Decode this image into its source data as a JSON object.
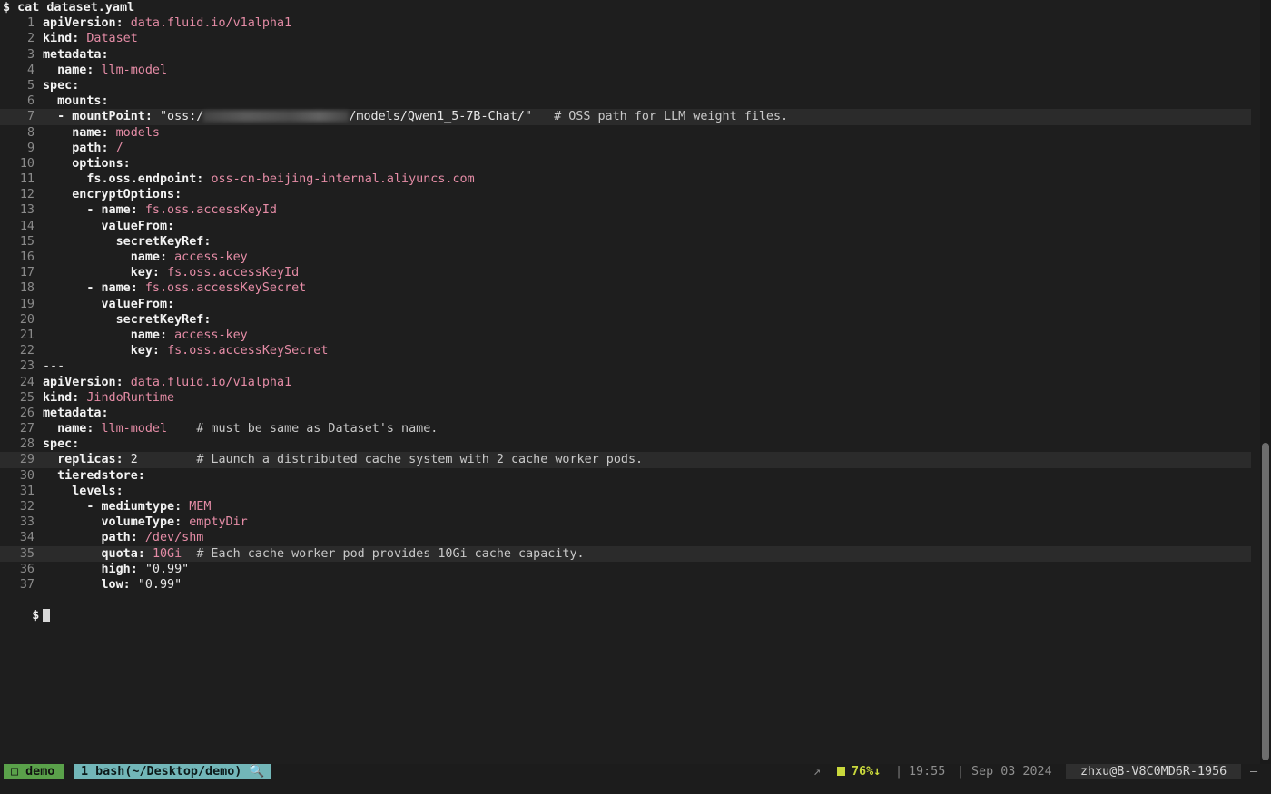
{
  "command": "$ cat dataset.yaml",
  "end_prompt": "$",
  "redacted_segment_icon": "blurred-redaction",
  "lines": [
    {
      "n": "1",
      "t": [
        [
          "key",
          "apiVersion:"
        ],
        [
          "plain",
          " "
        ],
        [
          "val",
          "data.fluid.io/v1alpha1"
        ]
      ]
    },
    {
      "n": "2",
      "t": [
        [
          "key",
          "kind:"
        ],
        [
          "plain",
          " "
        ],
        [
          "val",
          "Dataset"
        ]
      ]
    },
    {
      "n": "3",
      "t": [
        [
          "key",
          "metadata:"
        ]
      ]
    },
    {
      "n": "4",
      "t": [
        [
          "plain",
          "  "
        ],
        [
          "key",
          "name:"
        ],
        [
          "plain",
          " "
        ],
        [
          "val",
          "llm-model"
        ]
      ]
    },
    {
      "n": "5",
      "t": [
        [
          "key",
          "spec:"
        ]
      ]
    },
    {
      "n": "6",
      "t": [
        [
          "plain",
          "  "
        ],
        [
          "key",
          "mounts:"
        ]
      ]
    },
    {
      "n": "7",
      "hl": true,
      "t": [
        [
          "plain",
          "  "
        ],
        [
          "key",
          "- mountPoint:"
        ],
        [
          "plain",
          " "
        ],
        [
          "str",
          "\"oss:/"
        ],
        [
          "redact",
          ""
        ],
        [
          "str",
          "/models/Qwen1_5-7B-Chat/\""
        ],
        [
          "plain",
          "   "
        ],
        [
          "cmt",
          "# OSS path for LLM weight files."
        ]
      ]
    },
    {
      "n": "8",
      "t": [
        [
          "plain",
          "    "
        ],
        [
          "key",
          "name:"
        ],
        [
          "plain",
          " "
        ],
        [
          "val",
          "models"
        ]
      ]
    },
    {
      "n": "9",
      "t": [
        [
          "plain",
          "    "
        ],
        [
          "key",
          "path:"
        ],
        [
          "plain",
          " "
        ],
        [
          "val",
          "/"
        ]
      ]
    },
    {
      "n": "10",
      "t": [
        [
          "plain",
          "    "
        ],
        [
          "key",
          "options:"
        ]
      ]
    },
    {
      "n": "11",
      "t": [
        [
          "plain",
          "      "
        ],
        [
          "key",
          "fs.oss.endpoint:"
        ],
        [
          "plain",
          " "
        ],
        [
          "val",
          "oss-cn-beijing-internal.aliyuncs.com"
        ]
      ]
    },
    {
      "n": "12",
      "t": [
        [
          "plain",
          "    "
        ],
        [
          "key",
          "encryptOptions:"
        ]
      ]
    },
    {
      "n": "13",
      "t": [
        [
          "plain",
          "      "
        ],
        [
          "key",
          "- name:"
        ],
        [
          "plain",
          " "
        ],
        [
          "val",
          "fs.oss.accessKeyId"
        ]
      ]
    },
    {
      "n": "14",
      "t": [
        [
          "plain",
          "        "
        ],
        [
          "key",
          "valueFrom:"
        ]
      ]
    },
    {
      "n": "15",
      "t": [
        [
          "plain",
          "          "
        ],
        [
          "key",
          "secretKeyRef:"
        ]
      ]
    },
    {
      "n": "16",
      "t": [
        [
          "plain",
          "            "
        ],
        [
          "key",
          "name:"
        ],
        [
          "plain",
          " "
        ],
        [
          "val",
          "access-key"
        ]
      ]
    },
    {
      "n": "17",
      "t": [
        [
          "plain",
          "            "
        ],
        [
          "key",
          "key:"
        ],
        [
          "plain",
          " "
        ],
        [
          "val",
          "fs.oss.accessKeyId"
        ]
      ]
    },
    {
      "n": "18",
      "t": [
        [
          "plain",
          "      "
        ],
        [
          "key",
          "- name:"
        ],
        [
          "plain",
          " "
        ],
        [
          "val",
          "fs.oss.accessKeySecret"
        ]
      ]
    },
    {
      "n": "19",
      "t": [
        [
          "plain",
          "        "
        ],
        [
          "key",
          "valueFrom:"
        ]
      ]
    },
    {
      "n": "20",
      "t": [
        [
          "plain",
          "          "
        ],
        [
          "key",
          "secretKeyRef:"
        ]
      ]
    },
    {
      "n": "21",
      "t": [
        [
          "plain",
          "            "
        ],
        [
          "key",
          "name:"
        ],
        [
          "plain",
          " "
        ],
        [
          "val",
          "access-key"
        ]
      ]
    },
    {
      "n": "22",
      "t": [
        [
          "plain",
          "            "
        ],
        [
          "key",
          "key:"
        ],
        [
          "plain",
          " "
        ],
        [
          "val",
          "fs.oss.accessKeySecret"
        ]
      ]
    },
    {
      "n": "23",
      "t": [
        [
          "plain",
          "---"
        ]
      ]
    },
    {
      "n": "24",
      "t": [
        [
          "key",
          "apiVersion:"
        ],
        [
          "plain",
          " "
        ],
        [
          "val",
          "data.fluid.io/v1alpha1"
        ]
      ]
    },
    {
      "n": "25",
      "t": [
        [
          "key",
          "kind:"
        ],
        [
          "plain",
          " "
        ],
        [
          "val",
          "JindoRuntime"
        ]
      ]
    },
    {
      "n": "26",
      "t": [
        [
          "key",
          "metadata:"
        ]
      ]
    },
    {
      "n": "27",
      "t": [
        [
          "plain",
          "  "
        ],
        [
          "key",
          "name:"
        ],
        [
          "plain",
          " "
        ],
        [
          "val",
          "llm-model"
        ],
        [
          "plain",
          "    "
        ],
        [
          "cmt",
          "# must be same as Dataset's name."
        ]
      ]
    },
    {
      "n": "28",
      "t": [
        [
          "key",
          "spec:"
        ]
      ]
    },
    {
      "n": "29",
      "hl": true,
      "t": [
        [
          "plain",
          "  "
        ],
        [
          "key",
          "replicas:"
        ],
        [
          "plain",
          " "
        ],
        [
          "str",
          "2"
        ],
        [
          "plain",
          "        "
        ],
        [
          "cmt",
          "# Launch a distributed cache system with 2 cache worker pods."
        ]
      ]
    },
    {
      "n": "30",
      "t": [
        [
          "plain",
          "  "
        ],
        [
          "key",
          "tieredstore:"
        ]
      ]
    },
    {
      "n": "31",
      "t": [
        [
          "plain",
          "    "
        ],
        [
          "key",
          "levels:"
        ]
      ]
    },
    {
      "n": "32",
      "t": [
        [
          "plain",
          "      "
        ],
        [
          "key",
          "- mediumtype:"
        ],
        [
          "plain",
          " "
        ],
        [
          "val",
          "MEM"
        ]
      ]
    },
    {
      "n": "33",
      "t": [
        [
          "plain",
          "        "
        ],
        [
          "key",
          "volumeType:"
        ],
        [
          "plain",
          " "
        ],
        [
          "val",
          "emptyDir"
        ]
      ]
    },
    {
      "n": "34",
      "t": [
        [
          "plain",
          "        "
        ],
        [
          "key",
          "path:"
        ],
        [
          "plain",
          " "
        ],
        [
          "val",
          "/dev/shm"
        ]
      ]
    },
    {
      "n": "35",
      "hl": true,
      "t": [
        [
          "plain",
          "        "
        ],
        [
          "key",
          "quota:"
        ],
        [
          "plain",
          " "
        ],
        [
          "val",
          "10Gi"
        ],
        [
          "plain",
          "  "
        ],
        [
          "cmt",
          "# Each cache worker pod provides 10Gi cache capacity."
        ]
      ]
    },
    {
      "n": "36",
      "t": [
        [
          "plain",
          "        "
        ],
        [
          "key",
          "high:"
        ],
        [
          "plain",
          " "
        ],
        [
          "str",
          "\"0.99\""
        ]
      ]
    },
    {
      "n": "37",
      "t": [
        [
          "plain",
          "        "
        ],
        [
          "key",
          "low:"
        ],
        [
          "plain",
          " "
        ],
        [
          "str",
          "\"0.99\""
        ]
      ]
    }
  ],
  "status": {
    "session": "□ demo",
    "window": "1 bash(~/Desktop/demo)",
    "window_icon": "magnifier-icon",
    "arrow": "↗",
    "battery": "76%↓",
    "sep": "|",
    "time": "19:55",
    "date": "Sep 03 2024",
    "host": "zhxu@B-V8C0MD6R-1956",
    "trail": "–"
  },
  "colors": {
    "background": "#1e1e1e",
    "key": "#f2f2f2",
    "value": "#e58ca6",
    "line_number": "#8a8a8a",
    "session_bg": "#5aa14a",
    "window_bg": "#72b6b8",
    "battery": "#c9d83c"
  }
}
